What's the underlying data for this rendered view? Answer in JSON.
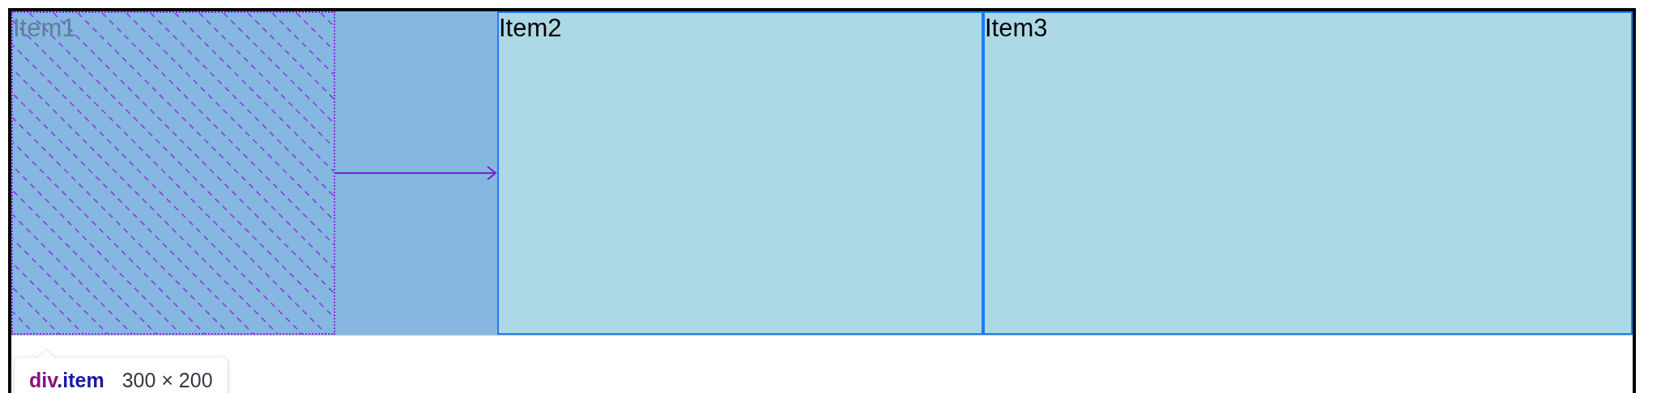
{
  "flex_items": [
    {
      "label": "Item1",
      "highlighted": true
    },
    {
      "label": "Item2",
      "highlighted": false
    },
    {
      "label": "Item3",
      "highlighted": false
    }
  ],
  "tooltip": {
    "tag": "div",
    "class_name": ".item",
    "size": "300 × 200"
  }
}
